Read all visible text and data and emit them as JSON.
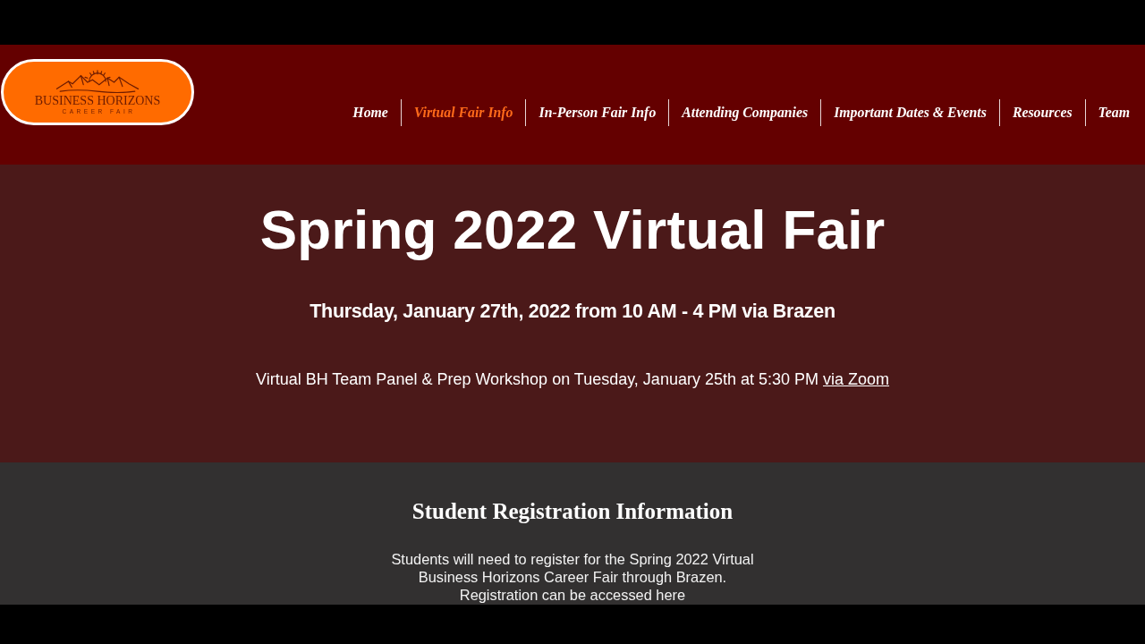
{
  "header": {
    "logo": {
      "title": "BUSINESS HORIZONS",
      "subtitle": "CAREER FAIR"
    },
    "nav": [
      {
        "label": "Home",
        "selected": false
      },
      {
        "label": "Virtual Fair Info",
        "selected": true
      },
      {
        "label": "In-Person Fair Info",
        "selected": false
      },
      {
        "label": "Attending Companies",
        "selected": false
      },
      {
        "label": "Important Dates & Events",
        "selected": false
      },
      {
        "label": "Resources",
        "selected": false
      },
      {
        "label": "Team",
        "selected": false
      }
    ]
  },
  "hero": {
    "title": "Spring 2022 Virtual Fair",
    "date_line": "Thursday, January 27th, 2022 from 10 AM - 4 PM via Brazen",
    "workshop": {
      "text": "Virtual BH Team Panel & Prep Workshop on Tuesday, January 25th at 5:30 PM",
      "link": "via Zoom"
    }
  },
  "registration": {
    "heading": "Student Registration Information",
    "paragraph_lines": [
      "Students will need to register for the Spring 2022 Virtual",
      "Business Horizons Career Fair through Brazen.",
      "Registration can be accessed here"
    ]
  }
}
